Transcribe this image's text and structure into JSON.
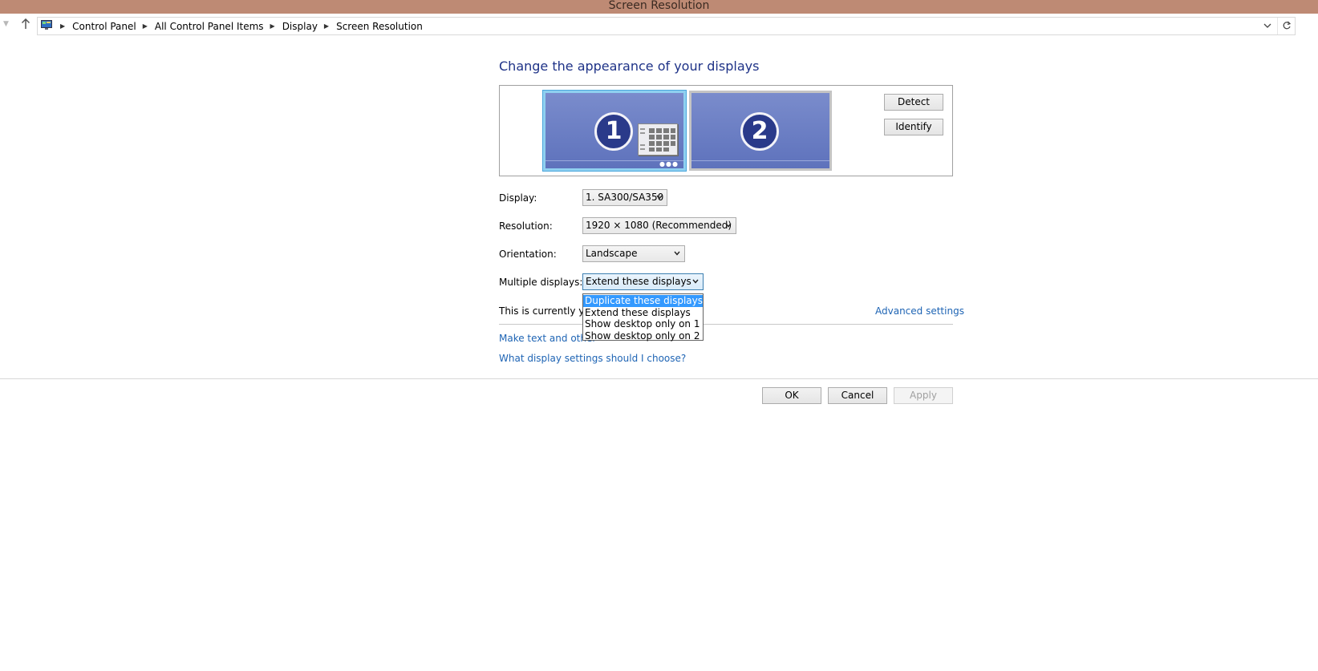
{
  "window": {
    "title": "Screen Resolution"
  },
  "breadcrumb": {
    "items": [
      "Control Panel",
      "All Control Panel Items",
      "Display",
      "Screen Resolution"
    ]
  },
  "main": {
    "heading": "Change the appearance of your displays",
    "monitors": [
      {
        "number": "1",
        "selected": true
      },
      {
        "number": "2",
        "selected": false
      }
    ],
    "detect_label": "Detect",
    "identify_label": "Identify",
    "fields": {
      "display_label": "Display:",
      "display_value": "1. SA300/SA350",
      "resolution_label": "Resolution:",
      "resolution_value": "1920 × 1080 (Recommended)",
      "orientation_label": "Orientation:",
      "orientation_value": "Landscape",
      "multiple_label": "Multiple displays:",
      "multiple_value": "Extend these displays"
    },
    "multiple_options": [
      "Duplicate these displays",
      "Extend these displays",
      "Show desktop only on 1",
      "Show desktop only on 2"
    ],
    "highlighted_option": "Duplicate these displays",
    "status_text": "This is currently you",
    "advanced_link": "Advanced settings",
    "text_size_link": "Make text and other",
    "help_link": "What display settings should I choose?"
  },
  "footer": {
    "ok_label": "OK",
    "cancel_label": "Cancel",
    "apply_label": "Apply"
  },
  "colors": {
    "titlebar": "#be8a74",
    "heading": "#1e3287",
    "link": "#1e64b4",
    "selection": "#3399ff"
  }
}
